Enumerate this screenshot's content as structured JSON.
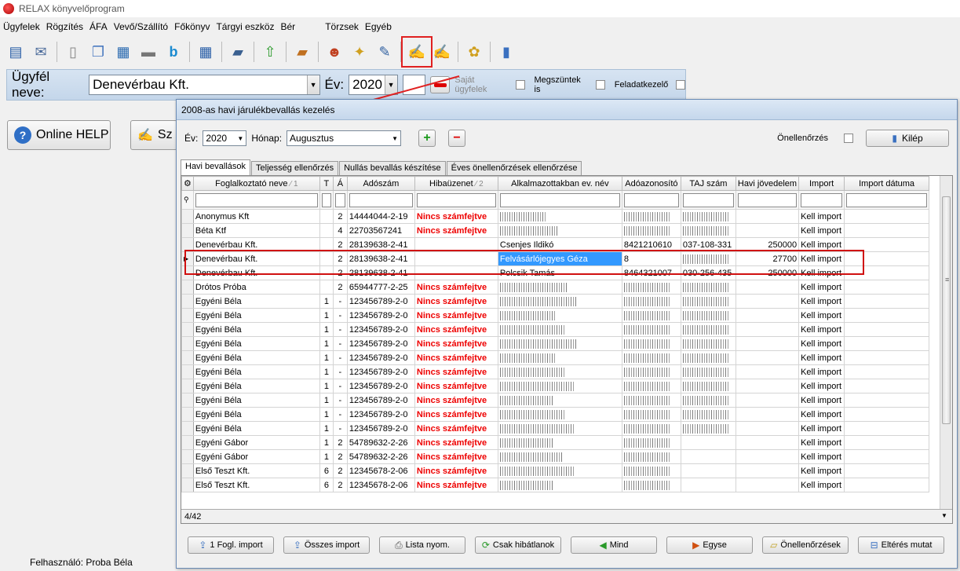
{
  "window": {
    "title": "RELAX könyvelőprogram"
  },
  "menu": [
    "Ügyfelek",
    "Rögzítés",
    "ÁFA",
    "Vevő/Szállító",
    "Főkönyv",
    "Tárgyi eszköz",
    "Bér",
    "Törzsek",
    "Egyéb"
  ],
  "clientbar": {
    "client_label": "Ügyfél neve:",
    "client_value": "Denevérbau Kft.",
    "year_label": "Év:",
    "year_value": "2020",
    "own_clients": "Saját ügyfelek",
    "terminated": "Megszüntek is",
    "task_manager": "Feladatkezelő"
  },
  "side": {
    "help_label": "Online HELP",
    "sz_label": "Sz"
  },
  "status": {
    "user": "Felhasználó: Proba Béla"
  },
  "dialog": {
    "title": "2008-as havi járulékbevallás kezelés",
    "year_label": "Év:",
    "year_value": "2020",
    "month_label": "Hónap:",
    "month_value": "Augusztus",
    "self_check_label": "Önellenőrzés",
    "exit_label": "Kilép",
    "tabs": [
      "Havi bevallások",
      "Teljesség ellenőrzés",
      "Nullás bevallás készítése",
      "Éves önellenőrzések ellenőrzése"
    ],
    "columns": [
      "Foglalkoztató neve",
      "T",
      "Á",
      "Adószám",
      "Hibaüzenet",
      "Alkalmazottakban ev. név",
      "Adóazonosító",
      "TAJ szám",
      "Havi jövedelem",
      "Import",
      "Import dátuma"
    ],
    "sort_marks": [
      "1",
      "2"
    ],
    "record_count": "4/42",
    "rows": [
      {
        "name": "Anonymus Kft",
        "t": "",
        "a": "2",
        "tax": "14444044-2-19",
        "err": "Nincs számfejtve",
        "emp": "",
        "taxid": "",
        "taj": "",
        "income": "",
        "import": "Kell import"
      },
      {
        "name": "Béta Ktf",
        "t": "",
        "a": "4",
        "tax": "22703567241",
        "err": "Nincs számfejtve",
        "emp": "",
        "taxid": "",
        "taj": "",
        "income": "",
        "import": "Kell import"
      },
      {
        "name": "Denevérbau Kft.",
        "t": "",
        "a": "2",
        "tax": "28139638-2-41",
        "err": "",
        "emp": "Csenjes Ildikó",
        "taxid": "8421210610",
        "taj": "037-108-331",
        "income": "250000",
        "import": "Kell import"
      },
      {
        "name": "Denevérbau Kft.",
        "t": "",
        "a": "2",
        "tax": "28139638-2-41",
        "err": "",
        "emp": "Felvásárlójegyes Géza",
        "taxid": "8",
        "taj": "",
        "income": "27700",
        "import": "Kell import"
      },
      {
        "name": "Denevérbau Kft.",
        "t": "",
        "a": "2",
        "tax": "28139638-2-41",
        "err": "",
        "emp": "Polcsik Tamás",
        "taxid": "8464321007",
        "taj": "030-256-435",
        "income": "250000",
        "import": "Kell import"
      },
      {
        "name": "Drótos Próba",
        "t": "",
        "a": "2",
        "tax": "65944777-2-25",
        "err": "Nincs számfejtve",
        "emp": "",
        "taxid": "",
        "taj": "",
        "income": "",
        "import": "Kell import"
      },
      {
        "name": "Egyéni Béla",
        "t": "1",
        "a": "-",
        "tax": "123456789-2-0",
        "err": "Nincs számfejtve",
        "emp": "",
        "taxid": "",
        "taj": "",
        "income": "",
        "import": "Kell import"
      },
      {
        "name": "Egyéni Béla",
        "t": "1",
        "a": "-",
        "tax": "123456789-2-0",
        "err": "Nincs számfejtve",
        "emp": "",
        "taxid": "",
        "taj": "",
        "income": "",
        "import": "Kell import"
      },
      {
        "name": "Egyéni Béla",
        "t": "1",
        "a": "-",
        "tax": "123456789-2-0",
        "err": "Nincs számfejtve",
        "emp": "",
        "taxid": "",
        "taj": "",
        "income": "",
        "import": "Kell import"
      },
      {
        "name": "Egyéni Béla",
        "t": "1",
        "a": "-",
        "tax": "123456789-2-0",
        "err": "Nincs számfejtve",
        "emp": "",
        "taxid": "",
        "taj": "",
        "income": "",
        "import": "Kell import"
      },
      {
        "name": "Egyéni Béla",
        "t": "1",
        "a": "-",
        "tax": "123456789-2-0",
        "err": "Nincs számfejtve",
        "emp": "",
        "taxid": "",
        "taj": "",
        "income": "",
        "import": "Kell import"
      },
      {
        "name": "Egyéni Béla",
        "t": "1",
        "a": "-",
        "tax": "123456789-2-0",
        "err": "Nincs számfejtve",
        "emp": "",
        "taxid": "",
        "taj": "",
        "income": "",
        "import": "Kell import"
      },
      {
        "name": "Egyéni Béla",
        "t": "1",
        "a": "-",
        "tax": "123456789-2-0",
        "err": "Nincs számfejtve",
        "emp": "",
        "taxid": "",
        "taj": "",
        "income": "",
        "import": "Kell import"
      },
      {
        "name": "Egyéni Béla",
        "t": "1",
        "a": "-",
        "tax": "123456789-2-0",
        "err": "Nincs számfejtve",
        "emp": "",
        "taxid": "",
        "taj": "",
        "income": "",
        "import": "Kell import"
      },
      {
        "name": "Egyéni Béla",
        "t": "1",
        "a": "-",
        "tax": "123456789-2-0",
        "err": "Nincs számfejtve",
        "emp": "",
        "taxid": "",
        "taj": "",
        "income": "",
        "import": "Kell import"
      },
      {
        "name": "Egyéni Béla",
        "t": "1",
        "a": "-",
        "tax": "123456789-2-0",
        "err": "Nincs számfejtve",
        "emp": "",
        "taxid": "",
        "taj": "",
        "income": "",
        "import": "Kell import"
      },
      {
        "name": "Egyéni Gábor",
        "t": "1",
        "a": "2",
        "tax": "54789632-2-26",
        "err": "Nincs számfejtve",
        "emp": "",
        "taxid": "",
        "taj": "",
        "income": "",
        "import": "Kell import"
      },
      {
        "name": "Egyéni Gábor",
        "t": "1",
        "a": "2",
        "tax": "54789632-2-26",
        "err": "Nincs számfejtve",
        "emp": "",
        "taxid": "",
        "taj": "",
        "income": "",
        "import": "Kell import"
      },
      {
        "name": "Első Teszt Kft.",
        "t": "6",
        "a": "2",
        "tax": "12345678-2-06",
        "err": "Nincs számfejtve",
        "emp": "",
        "taxid": "",
        "taj": "",
        "income": "",
        "import": "Kell import"
      },
      {
        "name": "Első Teszt Kft.",
        "t": "6",
        "a": "2",
        "tax": "12345678-2-06",
        "err": "Nincs számfejtve",
        "emp": "",
        "taxid": "",
        "taj": "",
        "income": "",
        "import": "Kell import"
      }
    ],
    "buttons": [
      "1 Fogl. import",
      "Összes import",
      "Lista nyom.",
      "Csak hibátlanok",
      "Mind",
      "Egyse",
      "Önellenőrzések",
      "Eltérés mutat"
    ]
  }
}
